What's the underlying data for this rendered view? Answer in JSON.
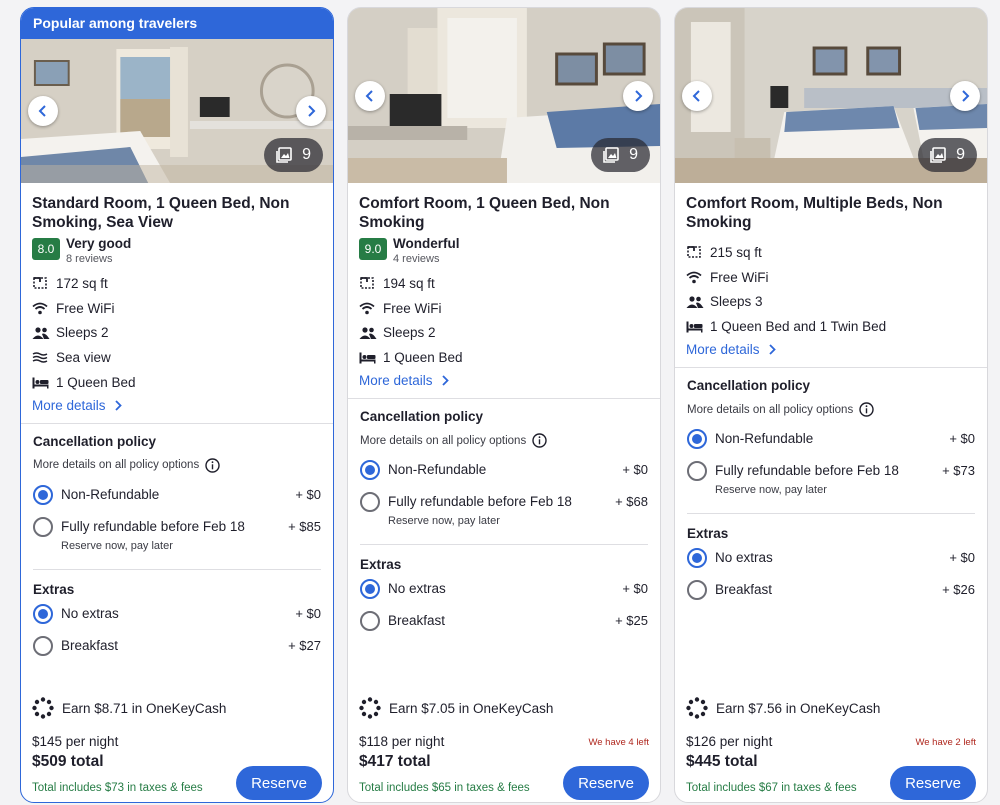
{
  "cards": [
    {
      "banner": "Popular among travelers",
      "photo_count": "9",
      "title": "Standard Room, 1 Queen Bed, Non Smoking, Sea View",
      "rating": {
        "score": "8.0",
        "label": "Very good",
        "reviews": "8 reviews"
      },
      "amenities": [
        {
          "icon": "floor-plan-icon",
          "text": "172 sq ft"
        },
        {
          "icon": "wifi-icon",
          "text": "Free WiFi"
        },
        {
          "icon": "people-icon",
          "text": "Sleeps 2"
        },
        {
          "icon": "waves-icon",
          "text": "Sea view"
        },
        {
          "icon": "bed-icon",
          "text": "1 Queen Bed"
        }
      ],
      "more_details": "More details",
      "cancellation": {
        "heading": "Cancellation policy",
        "note": "More details on all policy options",
        "options": [
          {
            "label": "Non-Refundable",
            "sub": "",
            "price": "+ $0",
            "selected": true
          },
          {
            "label": "Fully refundable before Feb 18",
            "sub": "Reserve now, pay later",
            "price": "+ $85",
            "selected": false
          }
        ]
      },
      "extras": {
        "heading": "Extras",
        "options": [
          {
            "label": "No extras",
            "price": "+ $0",
            "selected": true
          },
          {
            "label": "Breakfast",
            "price": "+ $27",
            "selected": false
          }
        ]
      },
      "earn": "Earn $8.71 in OneKeyCash",
      "per_night": "$145 per night",
      "total": "$509 total",
      "taxes": "Total includes $73 in taxes & fees",
      "left_note": "",
      "reserve": "Reserve"
    },
    {
      "banner": "",
      "photo_count": "9",
      "title": "Comfort Room, 1 Queen Bed, Non Smoking",
      "rating": {
        "score": "9.0",
        "label": "Wonderful",
        "reviews": "4 reviews"
      },
      "amenities": [
        {
          "icon": "floor-plan-icon",
          "text": "194 sq ft"
        },
        {
          "icon": "wifi-icon",
          "text": "Free WiFi"
        },
        {
          "icon": "people-icon",
          "text": "Sleeps 2"
        },
        {
          "icon": "bed-icon",
          "text": "1 Queen Bed"
        }
      ],
      "more_details": "More details",
      "cancellation": {
        "heading": "Cancellation policy",
        "note": "More details on all policy options",
        "options": [
          {
            "label": "Non-Refundable",
            "sub": "",
            "price": "+ $0",
            "selected": true
          },
          {
            "label": "Fully refundable before Feb 18",
            "sub": "Reserve now, pay later",
            "price": "+ $68",
            "selected": false
          }
        ]
      },
      "extras": {
        "heading": "Extras",
        "options": [
          {
            "label": "No extras",
            "price": "+ $0",
            "selected": true
          },
          {
            "label": "Breakfast",
            "price": "+ $25",
            "selected": false
          }
        ]
      },
      "earn": "Earn $7.05 in OneKeyCash",
      "per_night": "$118 per night",
      "total": "$417 total",
      "taxes": "Total includes $65 in taxes & fees",
      "left_note": "We have 4 left",
      "reserve": "Reserve"
    },
    {
      "banner": "",
      "photo_count": "9",
      "title": "Comfort Room, Multiple Beds, Non Smoking",
      "rating": null,
      "amenities": [
        {
          "icon": "floor-plan-icon",
          "text": "215 sq ft"
        },
        {
          "icon": "wifi-icon",
          "text": "Free WiFi"
        },
        {
          "icon": "people-icon",
          "text": "Sleeps 3"
        },
        {
          "icon": "bed-icon",
          "text": "1 Queen Bed and 1 Twin Bed"
        }
      ],
      "more_details": "More details",
      "cancellation": {
        "heading": "Cancellation policy",
        "note": "More details on all policy options",
        "options": [
          {
            "label": "Non-Refundable",
            "sub": "",
            "price": "+ $0",
            "selected": true
          },
          {
            "label": "Fully refundable before Feb 18",
            "sub": "Reserve now, pay later",
            "price": "+ $73",
            "selected": false
          }
        ]
      },
      "extras": {
        "heading": "Extras",
        "options": [
          {
            "label": "No extras",
            "price": "+ $0",
            "selected": true
          },
          {
            "label": "Breakfast",
            "price": "+ $26",
            "selected": false
          }
        ]
      },
      "earn": "Earn $7.56 in OneKeyCash",
      "per_night": "$126 per night",
      "total": "$445 total",
      "taxes": "Total includes $67 in taxes & fees",
      "left_note": "We have 2 left",
      "reserve": "Reserve"
    }
  ],
  "colors": {
    "brand_blue": "#2e67d9",
    "rating_green": "#267c45",
    "scarcity_red": "#b0281f"
  }
}
